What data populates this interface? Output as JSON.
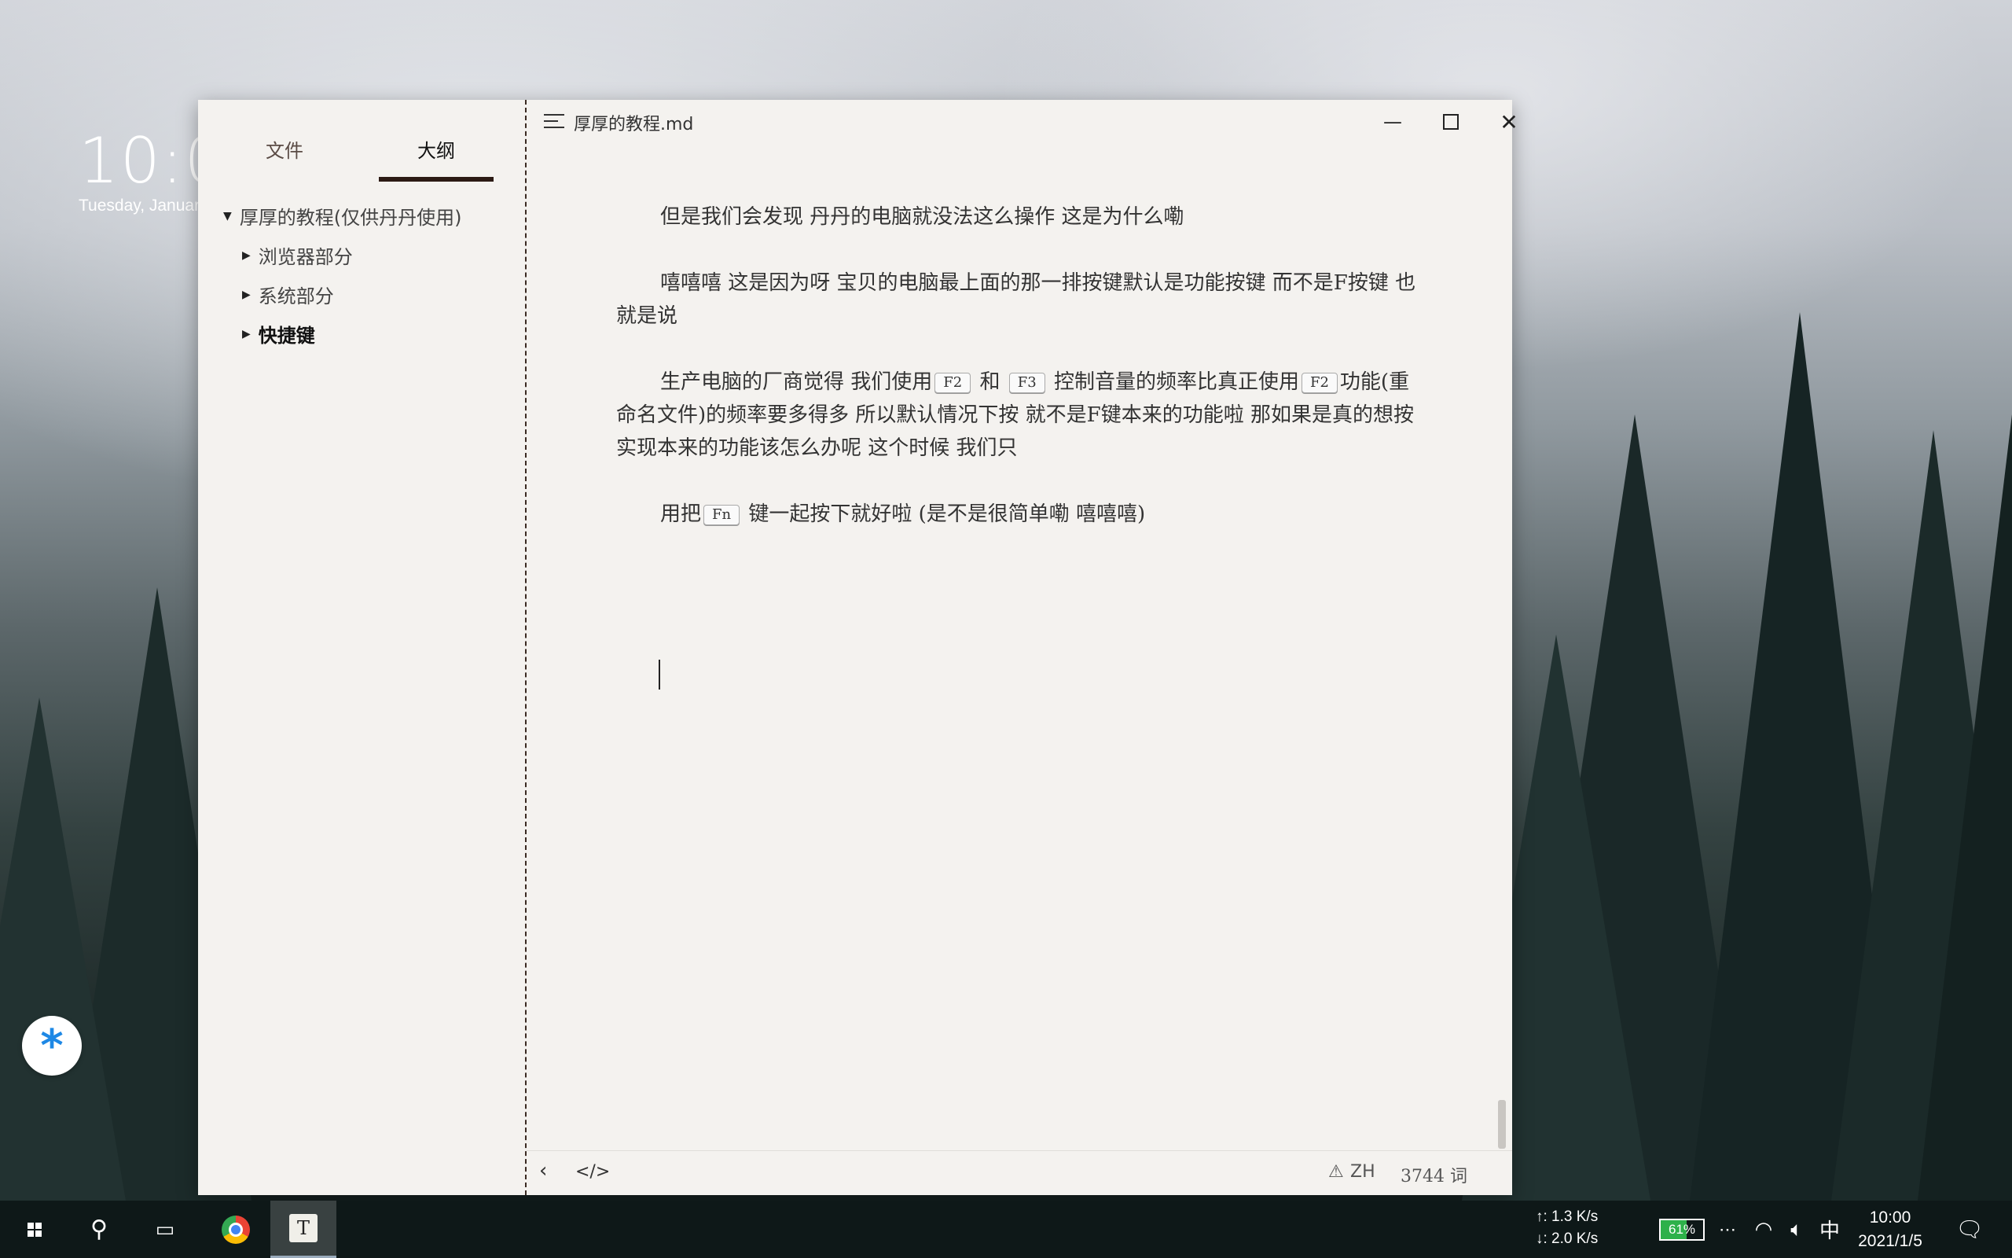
{
  "desktop": {
    "clock_time": "10:0",
    "clock_date": "Tuesday, Januar"
  },
  "sidebar": {
    "tabs": [
      {
        "label": "文件"
      },
      {
        "label": "大纲"
      }
    ],
    "outline": {
      "root": "厚厚的教程(仅供丹丹使用)",
      "items": [
        {
          "label": "浏览器部分"
        },
        {
          "label": "系统部分"
        },
        {
          "label": "快捷键"
        }
      ]
    }
  },
  "window": {
    "title": "厚厚的教程.md"
  },
  "editor": {
    "para1": "但是我们会发现  丹丹的电脑就没法这么操作  这是为什么嘞",
    "para2": "嘻嘻嘻  这是因为呀  宝贝的电脑最上面的那一排按键默认是功能按键  而不是F按键   也就是说",
    "para3": {
      "t1": "生产电脑的厂商觉得  我们使用",
      "k1": "F2",
      "t2": " 和 ",
      "k2": "F3",
      "t3": " 控制音量的频率比真正使用",
      "k3": "F2",
      "t4": "功能(重命名文件)的频率要多得多  所以默认情况下按  就不是F键本来的功能啦  那如果是真的想按 实现本来的功能该怎么办呢   这个时候  我们只"
    },
    "para4": {
      "t1": "用把",
      "k1": "Fn",
      "t2": " 键一起按下就好啦 (是不是很简单嘞  嘻嘻嘻)"
    }
  },
  "statusbar": {
    "lang": "ZH",
    "word_count": "3744 词"
  },
  "taskbar": {
    "net_up": "↑: 1.3 K/s",
    "net_down": "↓: 2.0 K/s",
    "battery": "61%",
    "battery_level": 0.61,
    "ime": "中",
    "time": "10:00",
    "date": "2021/1/5"
  },
  "colors": {
    "accent_tab": "#2c1a14",
    "battery_green": "#2db14a",
    "fab_blue": "#1e88e5"
  }
}
